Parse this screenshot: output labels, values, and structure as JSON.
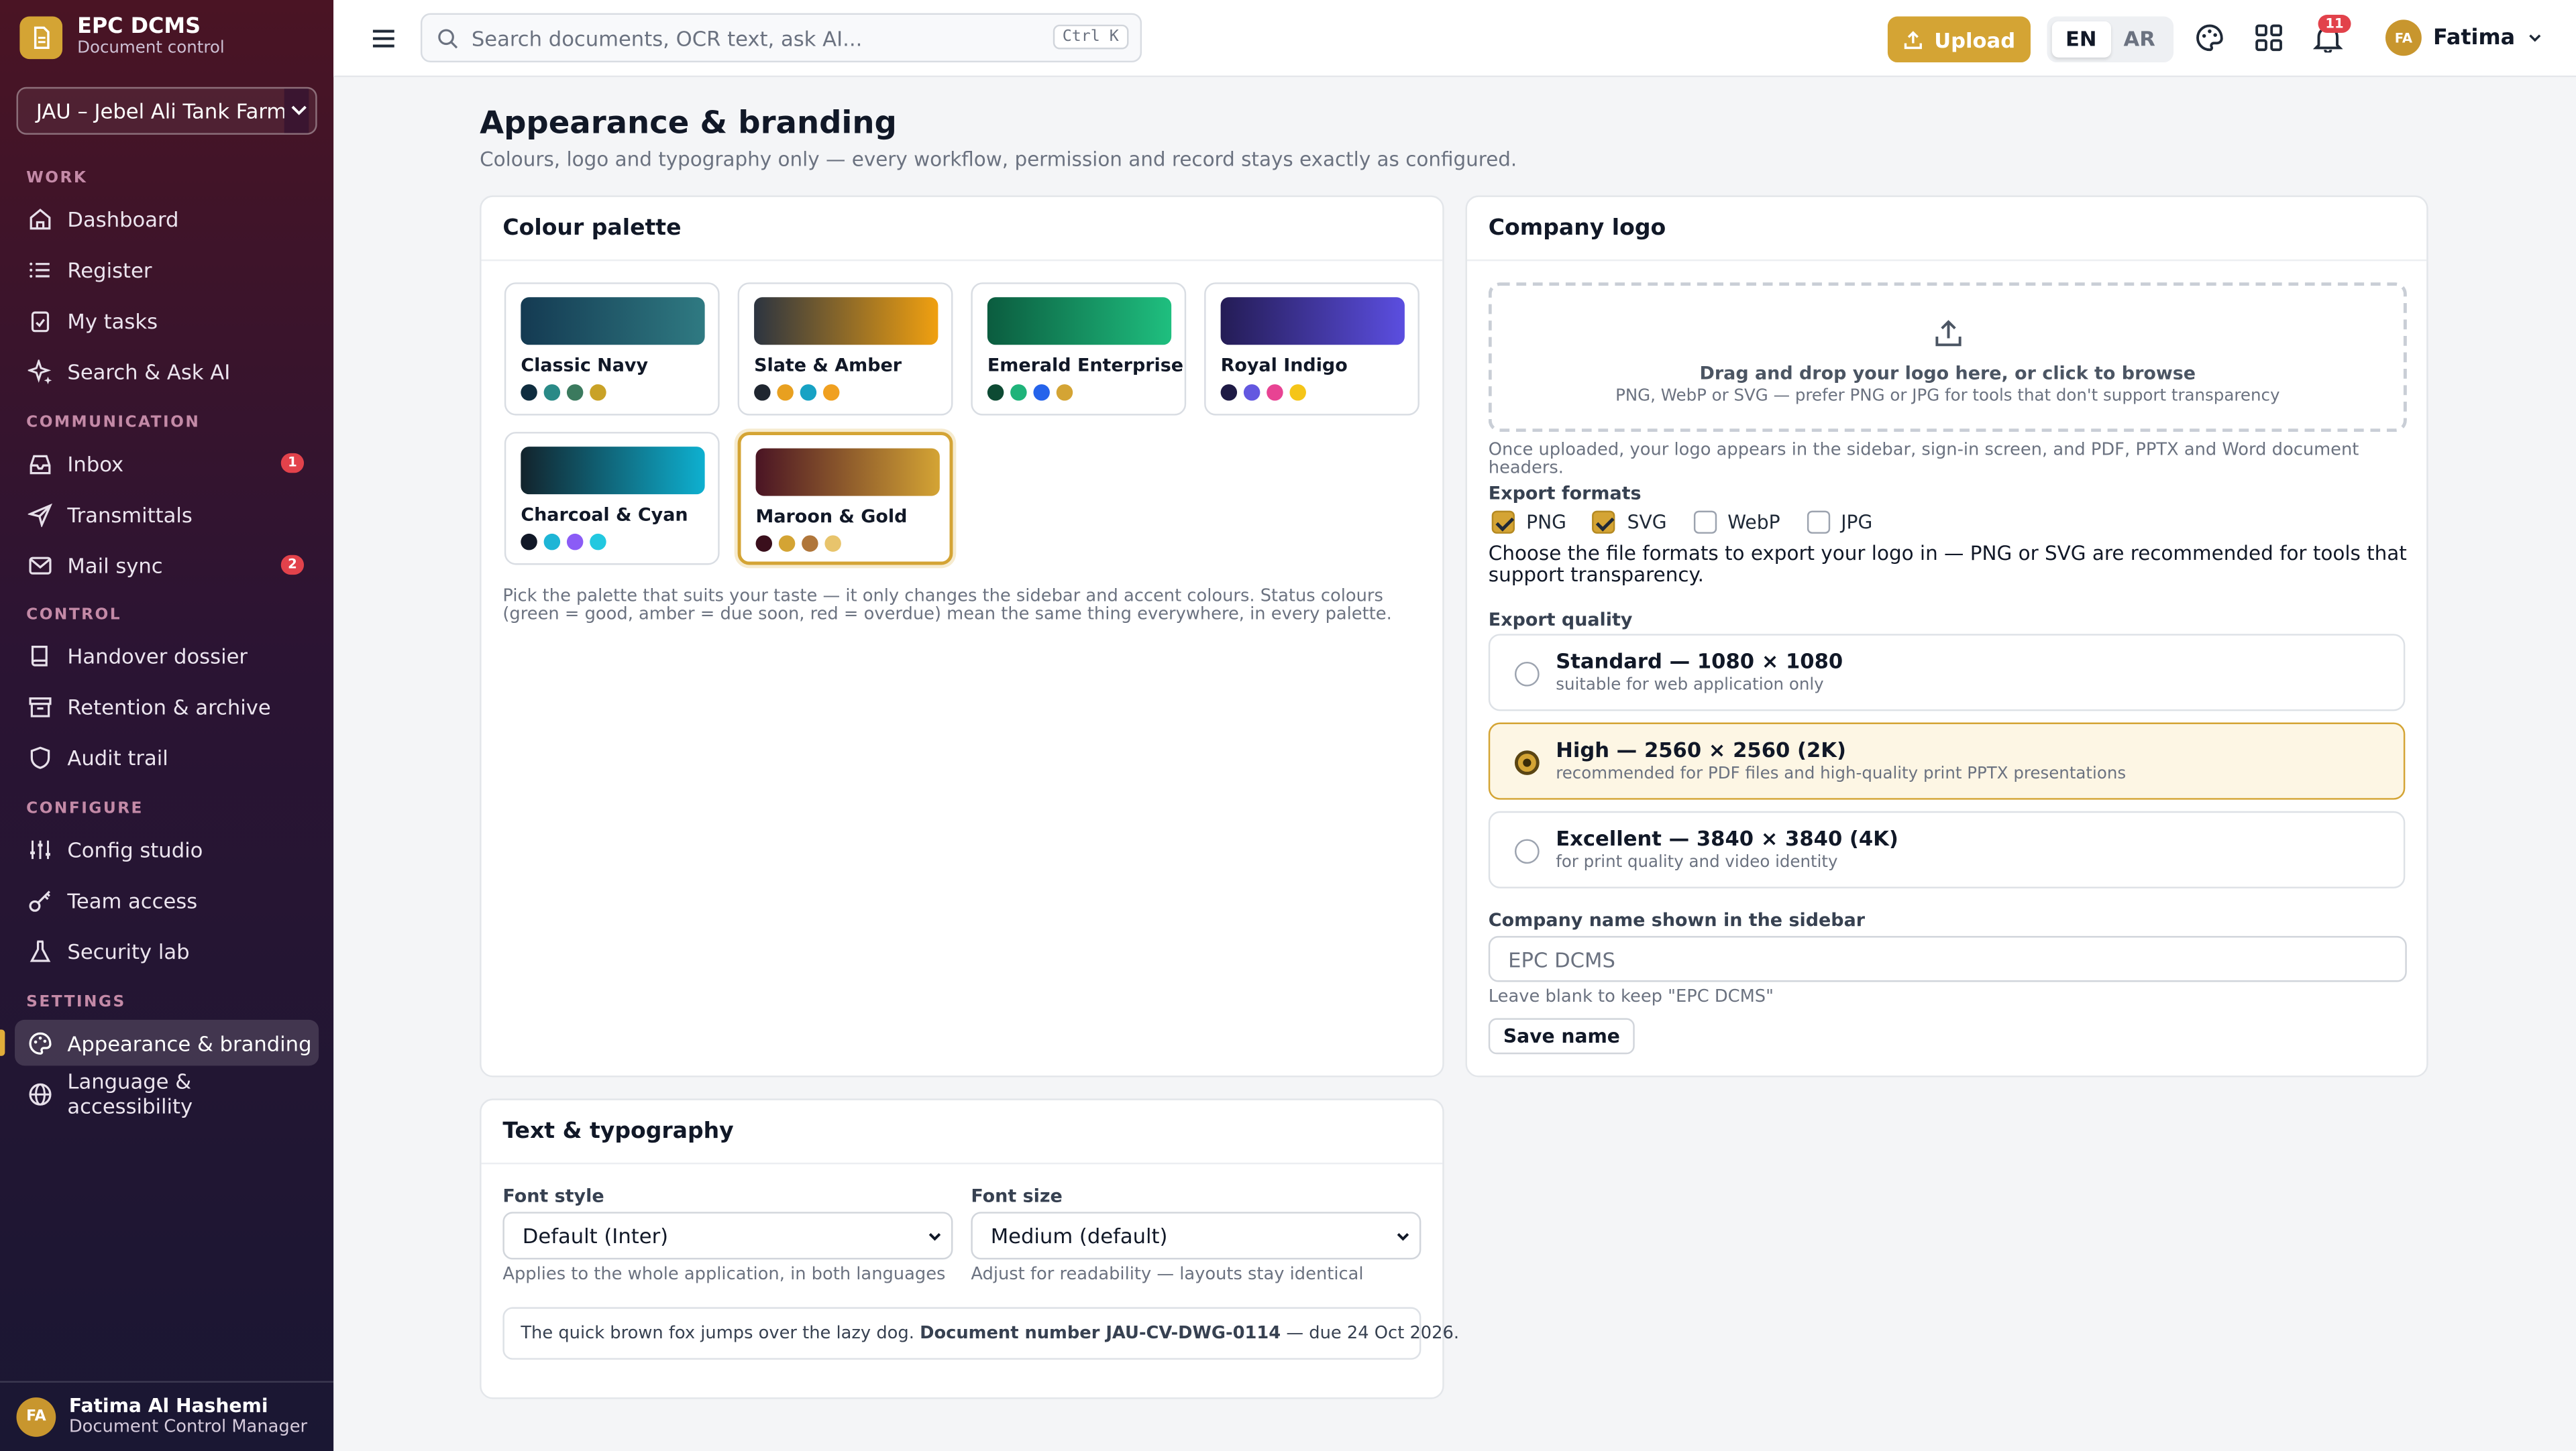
{
  "app": {
    "name": "EPC DCMS",
    "subtitle": "Document control",
    "project": "JAU – Jebel Ali Tank Farm E"
  },
  "sidebar": {
    "sections": {
      "work": "WORK",
      "communication": "COMMUNICATION",
      "control": "CONTROL",
      "configure": "CONFIGURE",
      "settings": "SETTINGS"
    },
    "items": {
      "dashboard": "Dashboard",
      "register": "Register",
      "my_tasks": "My tasks",
      "search_ai": "Search & Ask AI",
      "inbox": "Inbox",
      "inbox_badge": "1",
      "transmittals": "Transmittals",
      "mail_sync": "Mail sync",
      "mail_badge": "2",
      "handover": "Handover dossier",
      "retention": "Retention & archive",
      "audit": "Audit trail",
      "config_studio": "Config studio",
      "team_access": "Team access",
      "security_lab": "Security lab",
      "appearance": "Appearance & branding",
      "language": "Language & accessibility"
    },
    "user": {
      "initials": "FA",
      "name": "Fatima Al Hashemi",
      "role": "Document Control Manager"
    }
  },
  "topbar": {
    "search_placeholder": "Search documents, OCR text, ask AI...",
    "shortcut": "Ctrl K",
    "upload": "Upload",
    "lang_en": "EN",
    "lang_ar": "AR",
    "notifications": "11",
    "user_initials": "FA",
    "user_name": "Fatima"
  },
  "page": {
    "title": "Appearance & branding",
    "subtitle": "Colours, logo and typography only — every workflow, permission and record stays exactly as configured."
  },
  "palette": {
    "title": "Colour palette",
    "options": [
      {
        "name": "Classic Navy",
        "gradient": [
          "#143a52",
          "#2f7a82"
        ],
        "dots": [
          "#0f2d3f",
          "#2a8a87",
          "#3b7a5e",
          "#c9a227"
        ]
      },
      {
        "name": "Slate & Amber",
        "gradient": [
          "#2c3440",
          "#f0a010"
        ],
        "dots": [
          "#1f2630",
          "#e8a020",
          "#17a2c4",
          "#f0a020"
        ]
      },
      {
        "name": "Emerald Enterprise",
        "gradient": [
          "#0b5c3f",
          "#1fbf7f"
        ],
        "dots": [
          "#0d4a33",
          "#1fb37a",
          "#2563eb",
          "#d4a434"
        ]
      },
      {
        "name": "Royal Indigo",
        "gradient": [
          "#241c55",
          "#5b4ee0"
        ],
        "dots": [
          "#1e1a45",
          "#6358e0",
          "#e84393",
          "#f5c518"
        ]
      },
      {
        "name": "Charcoal & Cyan",
        "gradient": [
          "#12232c",
          "#0eb0d0"
        ],
        "dots": [
          "#111827",
          "#1eb5d6",
          "#8b5cf6",
          "#22c8e0"
        ]
      },
      {
        "name": "Maroon & Gold",
        "gradient": [
          "#4a1424",
          "#d4a434"
        ],
        "dots": [
          "#3a0f1c",
          "#d4a434",
          "#b0763a",
          "#e8c46c"
        ]
      }
    ],
    "selected": "Maroon & Gold",
    "note": "Pick the palette that suits your taste — it only changes the sidebar and accent colours. Status colours (green = good, amber = due soon, red = overdue) mean the same thing everywhere, in every palette."
  },
  "logo": {
    "title": "Company logo",
    "drop_main": "Drag and drop your logo here, or click to browse",
    "drop_sub": "PNG, WebP or SVG — prefer PNG or JPG for tools that don't support transparency",
    "after_upload": "Once uploaded, your logo appears in the sidebar, sign-in screen, and PDF, PPTX and Word document headers.",
    "formats_label": "Export formats",
    "formats": [
      {
        "name": "PNG",
        "checked": true
      },
      {
        "name": "SVG",
        "checked": true
      },
      {
        "name": "WebP",
        "checked": false
      },
      {
        "name": "JPG",
        "checked": false
      }
    ],
    "formats_help": "Choose the file formats to export your logo in — PNG or SVG are recommended for tools that support transparency.",
    "quality_label": "Export quality",
    "quality": [
      {
        "title": "Standard — 1080 × 1080",
        "desc": "suitable for web application only",
        "selected": false
      },
      {
        "title": "High — 2560 × 2560 (2K)",
        "desc": "recommended for PDF files and high-quality print PPTX presentations",
        "selected": true
      },
      {
        "title": "Excellent — 3840 × 3840 (4K)",
        "desc": "for print quality and video identity",
        "selected": false
      }
    ],
    "company_label": "Company name shown in the sidebar",
    "company_placeholder": "EPC DCMS",
    "company_help": "Leave blank to keep \"EPC DCMS\"",
    "save": "Save name"
  },
  "typography": {
    "title": "Text & typography",
    "font_style_label": "Font style",
    "font_style_value": "Default (Inter)",
    "font_style_help": "Applies to the whole application, in both languages",
    "font_size_label": "Font size",
    "font_size_value": "Medium (default)",
    "font_size_help": "Adjust for readability — layouts stay identical",
    "preview_text": "The quick brown fox jumps over the lazy dog.",
    "preview_bold": "Document number JAU-CV-DWG-0114",
    "preview_tail": "— due 24 Oct 2026."
  },
  "colors": {
    "accent": "#d4a434",
    "sidebar_top": "#4a1424",
    "sidebar_bottom": "#1a1733",
    "danger": "#e2424b"
  }
}
